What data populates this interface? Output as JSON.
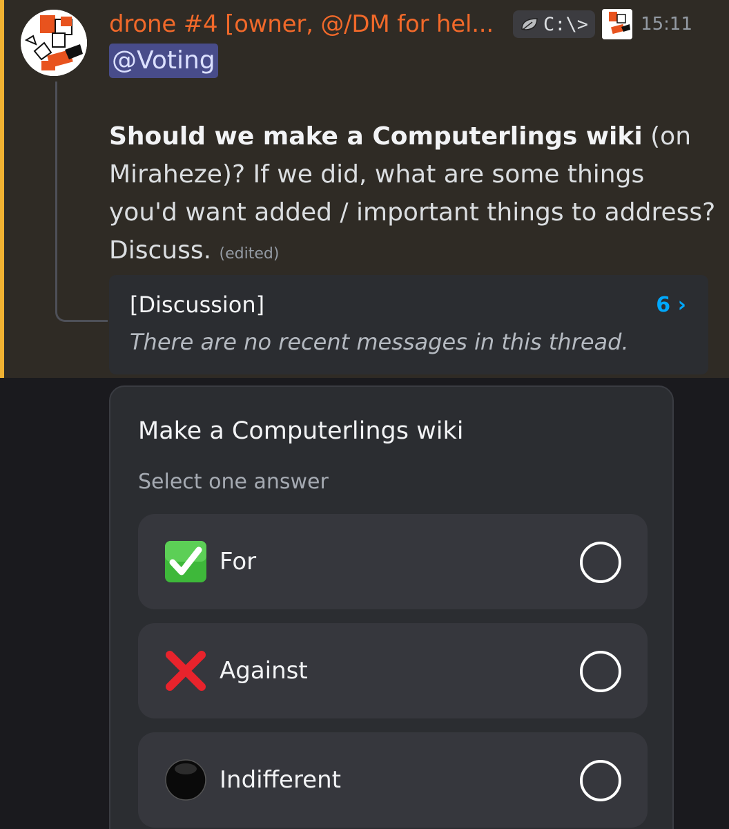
{
  "message": {
    "author": "drone #4 [owner, @/DM for hel...",
    "tag_label": "C:\\>",
    "timestamp": "15:11",
    "mention": "@Voting",
    "question_bold": "Should we make a Computerlings wiki",
    "question_rest": " (on Miraheze)? If we did, what are some things you'd want added / important things to address? Discuss.",
    "edited_label": "(edited)",
    "colors": {
      "author": "#f1692a",
      "mention_bar": "#f0b232",
      "mention_bg": "#484c8a"
    },
    "icons": {
      "avatar": "robot-avatar",
      "tag": "leaf-icon",
      "role": "role-icon"
    }
  },
  "thread": {
    "title": "[Discussion]",
    "count": "6",
    "count_arrow": "›",
    "empty_text": "There are no recent messages in this thread."
  },
  "poll": {
    "question": "Make a Computerlings wiki",
    "instruction": "Select one answer",
    "options": [
      {
        "emoji": "check-mark-button-icon",
        "label": "For"
      },
      {
        "emoji": "cross-mark-icon",
        "label": "Against"
      },
      {
        "emoji": "black-circle-icon",
        "label": "Indifferent"
      }
    ]
  }
}
